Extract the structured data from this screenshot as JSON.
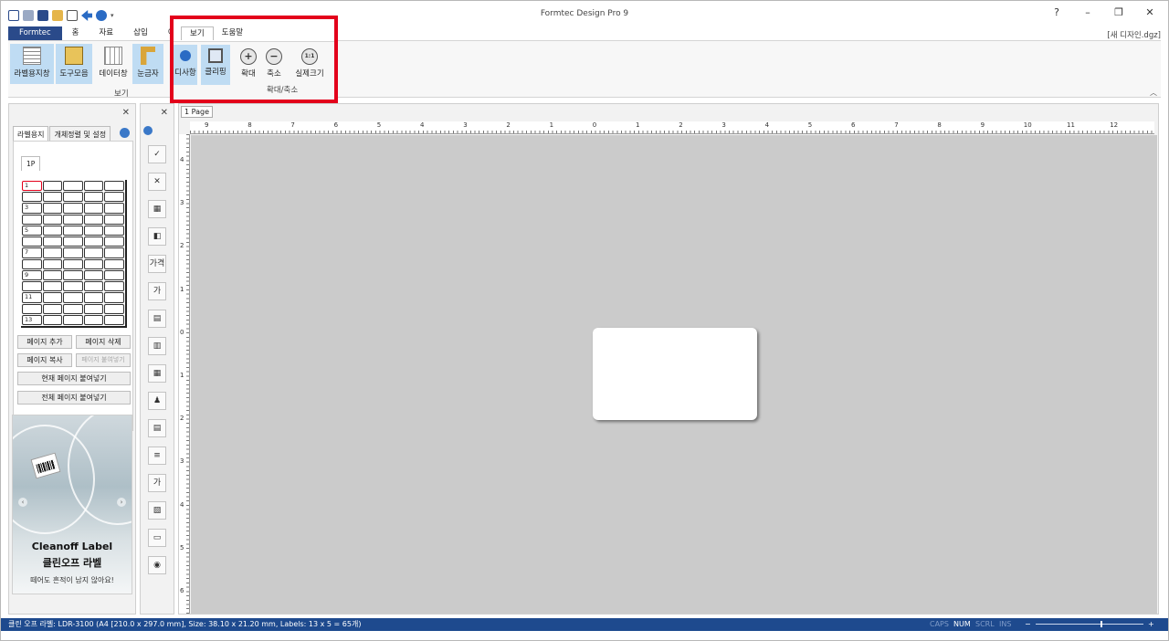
{
  "app": {
    "title": "Formtec Design Pro 9",
    "filename": "[새 디자인.dgz]",
    "window_controls": [
      "?",
      "–",
      "❐",
      "✕"
    ]
  },
  "ribbon": {
    "tabs": [
      "Formtec",
      "홈",
      "자료",
      "삽입",
      "이미지"
    ],
    "buttons": [
      "라벨용지창",
      "도구모음",
      "데이터창",
      "눈금자"
    ],
    "group_label": "보기"
  },
  "help_overlay": {
    "tabs": [
      "보기",
      "도움말"
    ],
    "buttons": [
      "디사항",
      "클리핑"
    ],
    "zoom_buttons": [
      {
        "label": "확대",
        "glyph": "+"
      },
      {
        "label": "축소",
        "glyph": "−"
      },
      {
        "label": "실제크기",
        "glyph": "1:1"
      }
    ],
    "group_label": "확대/축소"
  },
  "left_panel": {
    "close": "✕",
    "tabs": [
      "라벨용지",
      "개체정렬 및 설정"
    ],
    "page_tab": "1P",
    "row_numbers": [
      "1",
      "3",
      "5",
      "7",
      "9",
      "11",
      "13"
    ],
    "buttons": {
      "add_page": "페이지 추가",
      "delete_page": "페이지 삭제",
      "copy_page": "페이지 복사",
      "paste_page": "페이지 붙여넣기",
      "paste_current": "현재 페이지 붙여넣기",
      "paste_all": "전체 페이지 붙여넣기"
    },
    "ad": {
      "title": "Cleanoff Label",
      "subtitle": "클린오프 라벨",
      "note": "떼어도 흔적이 남지 않아요!"
    }
  },
  "tool_column": {
    "close": "✕",
    "tools": [
      "✓",
      "✕",
      "▦",
      "◧",
      "가격",
      "가",
      "▤",
      "▥",
      "▦",
      "♟",
      "▤",
      "≡",
      "가",
      "▧",
      "▭",
      "◉"
    ]
  },
  "canvas": {
    "page_tab": "1 Page",
    "h_ruler_numbers": [
      "9",
      "8",
      "7",
      "6",
      "5",
      "4",
      "3",
      "2",
      "1",
      "0",
      "1",
      "2",
      "3",
      "4",
      "5",
      "6",
      "7",
      "8",
      "9",
      "10",
      "11",
      "12"
    ],
    "v_ruler_numbers": [
      "4",
      "3",
      "2",
      "1",
      "0",
      "1",
      "2",
      "3",
      "4",
      "5",
      "6"
    ]
  },
  "status": {
    "text": "클린 오프 라벨: LDR-3100 (A4 [210.0 x 297.0 mm], Size: 38.10 x 21.20 mm,  Labels: 13 x 5 = 65개)",
    "caps": "CAPS",
    "num": "NUM",
    "scrl": "SCRL",
    "ins": "INS",
    "zoom_minus": "−",
    "zoom_plus": "+",
    "zoom_level": 0.6
  }
}
